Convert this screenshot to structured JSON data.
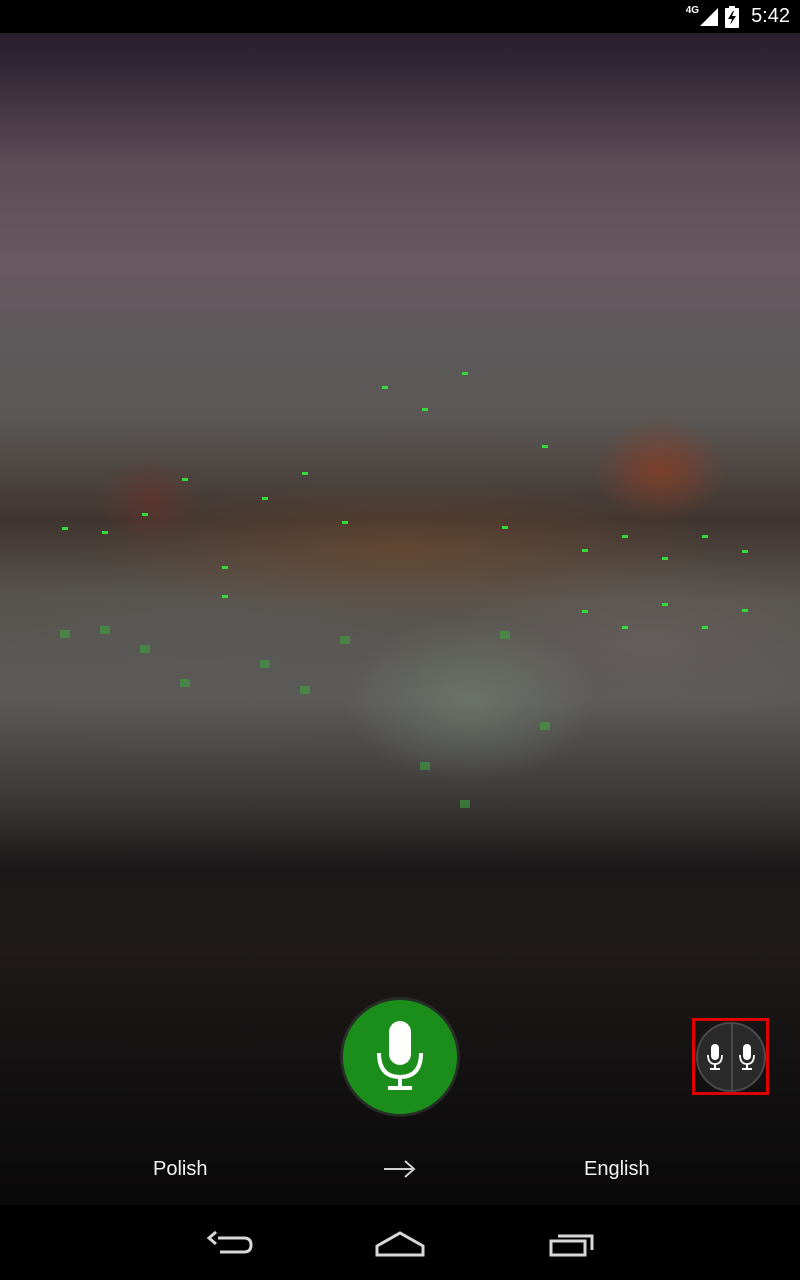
{
  "status_bar": {
    "network_type": "4G",
    "time": "5:42",
    "icons": [
      "signal-icon",
      "battery-charging-icon"
    ]
  },
  "colors": {
    "mic_green": "#1b8d1b",
    "highlight_red": "#e00000",
    "dot_green": "#35d93a"
  },
  "translator": {
    "mic_button_icon": "microphone-icon",
    "conversation_button_icon": "dual-microphone-icon",
    "source_language": "Polish",
    "target_language": "English",
    "swap_icon": "right-arrow-icon"
  },
  "nav_bar": {
    "buttons": [
      "back-icon",
      "home-icon",
      "recent-apps-icon"
    ]
  }
}
